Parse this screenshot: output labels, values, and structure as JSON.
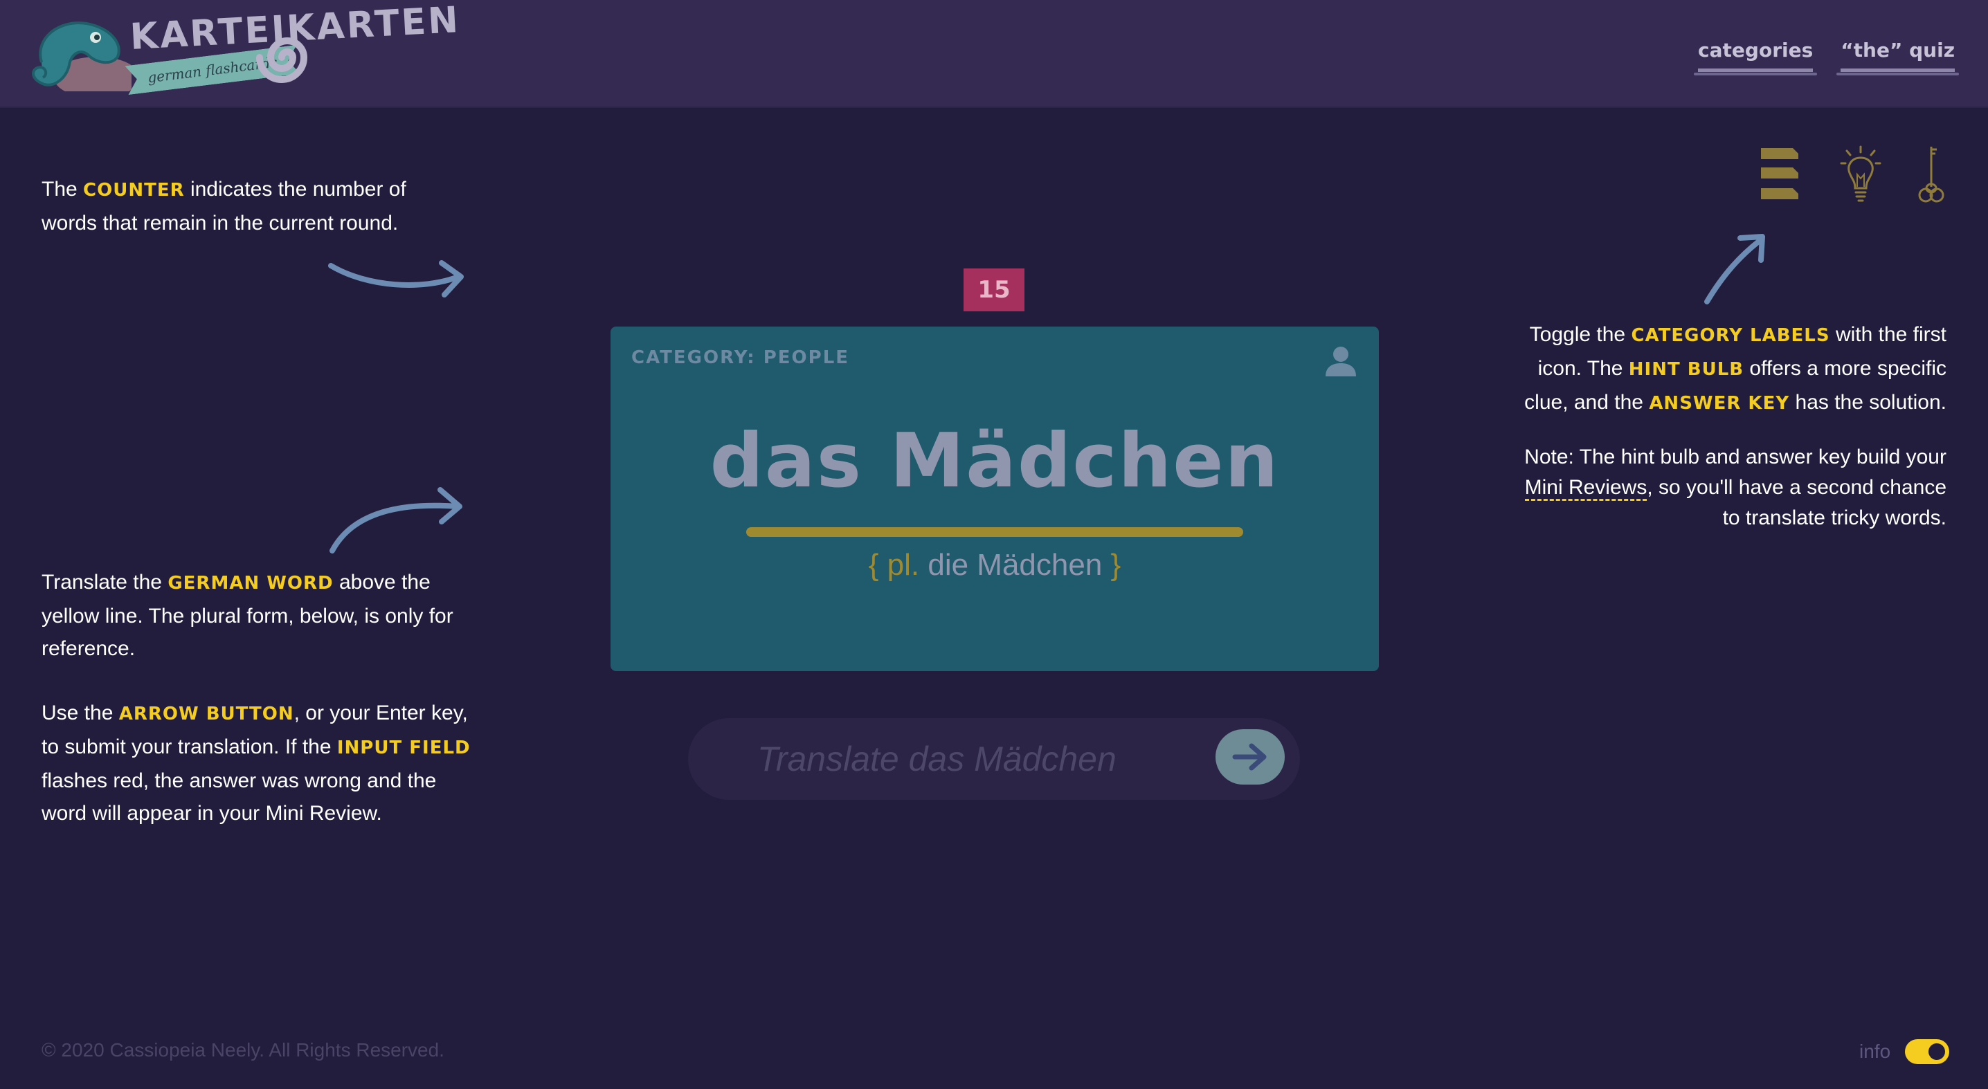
{
  "header": {
    "logo_title": "KARTEIKARTEN",
    "logo_subtitle": "german flashcards",
    "nav": [
      {
        "label": "categories"
      },
      {
        "label": "“the” quiz"
      }
    ]
  },
  "info_left_1": {
    "pre": "The ",
    "hl": "counter",
    "post": " indicates the number of words that remain in the current round."
  },
  "info_left_2": {
    "p1_pre": "Translate the ",
    "p1_hl": "German word",
    "p1_post": " above the yellow line. The plural form, below, is only for reference.",
    "p2_pre": "Use the ",
    "p2_hl1": "arrow button",
    "p2_mid": ", or your Enter key, to submit your translation. If the ",
    "p2_hl2": "input field",
    "p2_post": " flashes red, the answer was wrong and the word will appear in your Mini Review."
  },
  "info_right": {
    "p1_a": "Toggle the ",
    "p1_hl1": "category labels",
    "p1_b": " with the first icon. The ",
    "p1_hl2": "hint bulb",
    "p1_c": " offers a more specific clue, and the ",
    "p1_hl3": "answer key",
    "p1_d": " has the solution.",
    "p2_a": "Note: The hint bulb and answer key build your ",
    "p2_link": "Mini Reviews",
    "p2_b": ", so you'll have a second chance to translate tricky words."
  },
  "counter": "15",
  "card": {
    "category": "CATEGORY: PEOPLE",
    "word": "das Mädchen",
    "plural_open": "{ ",
    "plural_label": "pl.",
    "plural_word": " die Mädchen ",
    "plural_close": "}"
  },
  "answer": {
    "placeholder": "Translate das Mädchen"
  },
  "tools": [
    {
      "icon": "category-labels-icon"
    },
    {
      "icon": "hint-bulb-icon"
    },
    {
      "icon": "answer-key-icon"
    }
  ],
  "footer": {
    "copyright": "© 2020 Cassiopeia Neely. All Rights Reserved.",
    "toggle_label": "info",
    "toggle_on": true
  },
  "colors": {
    "background": "#221c3d",
    "header": "#352b52",
    "highlight": "#f5cd21",
    "card": "#1f5b6d",
    "counter": "#a5305e",
    "arrow": "#6c8cb4"
  }
}
